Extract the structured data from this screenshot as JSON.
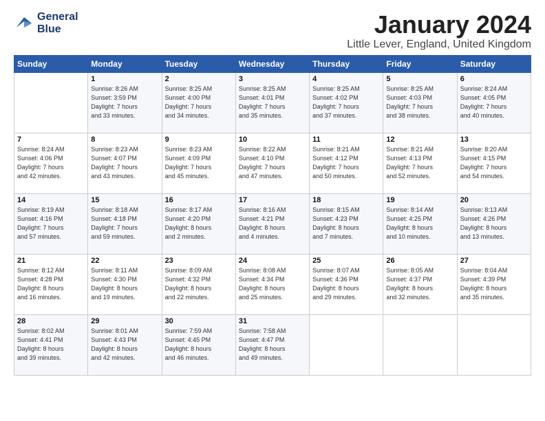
{
  "header": {
    "logo_line1": "General",
    "logo_line2": "Blue",
    "month": "January 2024",
    "location": "Little Lever, England, United Kingdom"
  },
  "days_of_week": [
    "Sunday",
    "Monday",
    "Tuesday",
    "Wednesday",
    "Thursday",
    "Friday",
    "Saturday"
  ],
  "weeks": [
    [
      {
        "day": "",
        "info": ""
      },
      {
        "day": "1",
        "info": "Sunrise: 8:26 AM\nSunset: 3:59 PM\nDaylight: 7 hours\nand 33 minutes."
      },
      {
        "day": "2",
        "info": "Sunrise: 8:25 AM\nSunset: 4:00 PM\nDaylight: 7 hours\nand 34 minutes."
      },
      {
        "day": "3",
        "info": "Sunrise: 8:25 AM\nSunset: 4:01 PM\nDaylight: 7 hours\nand 35 minutes."
      },
      {
        "day": "4",
        "info": "Sunrise: 8:25 AM\nSunset: 4:02 PM\nDaylight: 7 hours\nand 37 minutes."
      },
      {
        "day": "5",
        "info": "Sunrise: 8:25 AM\nSunset: 4:03 PM\nDaylight: 7 hours\nand 38 minutes."
      },
      {
        "day": "6",
        "info": "Sunrise: 8:24 AM\nSunset: 4:05 PM\nDaylight: 7 hours\nand 40 minutes."
      }
    ],
    [
      {
        "day": "7",
        "info": "Sunrise: 8:24 AM\nSunset: 4:06 PM\nDaylight: 7 hours\nand 42 minutes."
      },
      {
        "day": "8",
        "info": "Sunrise: 8:23 AM\nSunset: 4:07 PM\nDaylight: 7 hours\nand 43 minutes."
      },
      {
        "day": "9",
        "info": "Sunrise: 8:23 AM\nSunset: 4:09 PM\nDaylight: 7 hours\nand 45 minutes."
      },
      {
        "day": "10",
        "info": "Sunrise: 8:22 AM\nSunset: 4:10 PM\nDaylight: 7 hours\nand 47 minutes."
      },
      {
        "day": "11",
        "info": "Sunrise: 8:21 AM\nSunset: 4:12 PM\nDaylight: 7 hours\nand 50 minutes."
      },
      {
        "day": "12",
        "info": "Sunrise: 8:21 AM\nSunset: 4:13 PM\nDaylight: 7 hours\nand 52 minutes."
      },
      {
        "day": "13",
        "info": "Sunrise: 8:20 AM\nSunset: 4:15 PM\nDaylight: 7 hours\nand 54 minutes."
      }
    ],
    [
      {
        "day": "14",
        "info": "Sunrise: 8:19 AM\nSunset: 4:16 PM\nDaylight: 7 hours\nand 57 minutes."
      },
      {
        "day": "15",
        "info": "Sunrise: 8:18 AM\nSunset: 4:18 PM\nDaylight: 7 hours\nand 59 minutes."
      },
      {
        "day": "16",
        "info": "Sunrise: 8:17 AM\nSunset: 4:20 PM\nDaylight: 8 hours\nand 2 minutes."
      },
      {
        "day": "17",
        "info": "Sunrise: 8:16 AM\nSunset: 4:21 PM\nDaylight: 8 hours\nand 4 minutes."
      },
      {
        "day": "18",
        "info": "Sunrise: 8:15 AM\nSunset: 4:23 PM\nDaylight: 8 hours\nand 7 minutes."
      },
      {
        "day": "19",
        "info": "Sunrise: 8:14 AM\nSunset: 4:25 PM\nDaylight: 8 hours\nand 10 minutes."
      },
      {
        "day": "20",
        "info": "Sunrise: 8:13 AM\nSunset: 4:26 PM\nDaylight: 8 hours\nand 13 minutes."
      }
    ],
    [
      {
        "day": "21",
        "info": "Sunrise: 8:12 AM\nSunset: 4:28 PM\nDaylight: 8 hours\nand 16 minutes."
      },
      {
        "day": "22",
        "info": "Sunrise: 8:11 AM\nSunset: 4:30 PM\nDaylight: 8 hours\nand 19 minutes."
      },
      {
        "day": "23",
        "info": "Sunrise: 8:09 AM\nSunset: 4:32 PM\nDaylight: 8 hours\nand 22 minutes."
      },
      {
        "day": "24",
        "info": "Sunrise: 8:08 AM\nSunset: 4:34 PM\nDaylight: 8 hours\nand 25 minutes."
      },
      {
        "day": "25",
        "info": "Sunrise: 8:07 AM\nSunset: 4:36 PM\nDaylight: 8 hours\nand 29 minutes."
      },
      {
        "day": "26",
        "info": "Sunrise: 8:05 AM\nSunset: 4:37 PM\nDaylight: 8 hours\nand 32 minutes."
      },
      {
        "day": "27",
        "info": "Sunrise: 8:04 AM\nSunset: 4:39 PM\nDaylight: 8 hours\nand 35 minutes."
      }
    ],
    [
      {
        "day": "28",
        "info": "Sunrise: 8:02 AM\nSunset: 4:41 PM\nDaylight: 8 hours\nand 39 minutes."
      },
      {
        "day": "29",
        "info": "Sunrise: 8:01 AM\nSunset: 4:43 PM\nDaylight: 8 hours\nand 42 minutes."
      },
      {
        "day": "30",
        "info": "Sunrise: 7:59 AM\nSunset: 4:45 PM\nDaylight: 8 hours\nand 46 minutes."
      },
      {
        "day": "31",
        "info": "Sunrise: 7:58 AM\nSunset: 4:47 PM\nDaylight: 8 hours\nand 49 minutes."
      },
      {
        "day": "",
        "info": ""
      },
      {
        "day": "",
        "info": ""
      },
      {
        "day": "",
        "info": ""
      }
    ]
  ]
}
